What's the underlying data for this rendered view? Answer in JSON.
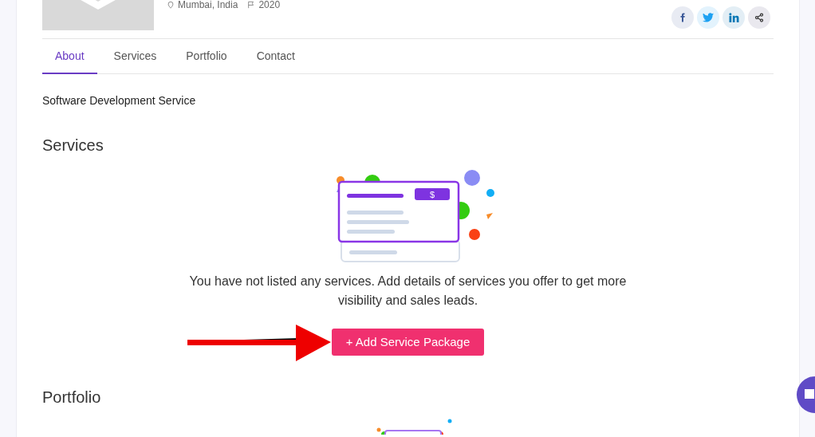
{
  "profile": {
    "location": "Mumbai, India",
    "year": "2020"
  },
  "social": [
    {
      "kind": "facebook"
    },
    {
      "kind": "twitter"
    },
    {
      "kind": "linkedin"
    },
    {
      "kind": "share"
    }
  ],
  "tabs": [
    {
      "label": "About",
      "selected": true
    },
    {
      "label": "Services",
      "selected": false
    },
    {
      "label": "Portfolio",
      "selected": false
    },
    {
      "label": "Contact",
      "selected": false
    }
  ],
  "about": "Software Development Service",
  "services": {
    "heading": "Services",
    "price_symbol": "$",
    "message": "You have not listed any services. Add details of services you offer to get more visibility and sales leads.",
    "button": "+ Add Service Package"
  },
  "portfolio": {
    "heading": "Portfolio"
  }
}
